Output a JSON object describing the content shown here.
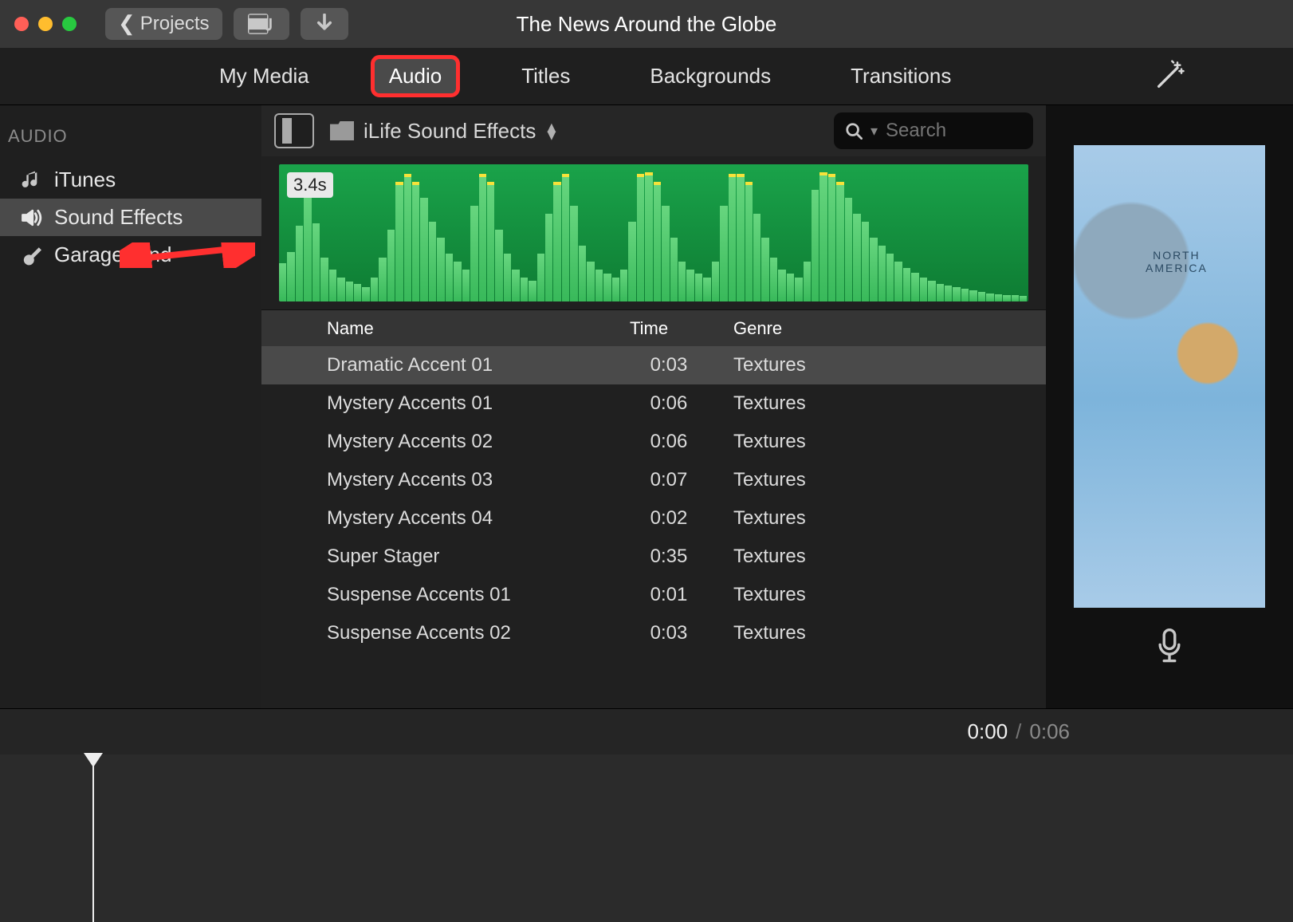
{
  "window": {
    "title": "The News Around the Globe"
  },
  "toolbar": {
    "projects_label": "Projects"
  },
  "tabs": {
    "items": [
      {
        "label": "My Media"
      },
      {
        "label": "Audio"
      },
      {
        "label": "Titles"
      },
      {
        "label": "Backgrounds"
      },
      {
        "label": "Transitions"
      }
    ],
    "active_index": 1
  },
  "sidebar": {
    "header": "AUDIO",
    "items": [
      {
        "label": "iTunes",
        "icon": "music-note-icon"
      },
      {
        "label": "Sound Effects",
        "icon": "speaker-icon"
      },
      {
        "label": "GarageBand",
        "icon": "guitar-icon"
      }
    ],
    "selected_index": 1
  },
  "browser": {
    "library_name": "iLife Sound Effects",
    "search_placeholder": "Search",
    "waveform_duration": "3.4s",
    "columns": {
      "name": "Name",
      "time": "Time",
      "genre": "Genre"
    },
    "rows": [
      {
        "name": "Dramatic Accent 01",
        "time": "0:03",
        "genre": "Textures"
      },
      {
        "name": "Mystery Accents 01",
        "time": "0:06",
        "genre": "Textures"
      },
      {
        "name": "Mystery Accents 02",
        "time": "0:06",
        "genre": "Textures"
      },
      {
        "name": "Mystery Accents 03",
        "time": "0:07",
        "genre": "Textures"
      },
      {
        "name": "Mystery Accents 04",
        "time": "0:02",
        "genre": "Textures"
      },
      {
        "name": "Super Stager",
        "time": "0:35",
        "genre": "Textures"
      },
      {
        "name": "Suspense Accents 01",
        "time": "0:01",
        "genre": "Textures"
      },
      {
        "name": "Suspense Accents 02",
        "time": "0:03",
        "genre": "Textures"
      }
    ],
    "selected_row": 0
  },
  "playback": {
    "current": "0:00",
    "duration": "0:06"
  },
  "annotations": {
    "arrow_target": "sidebar-panel-toggle",
    "highlight_tab": "Audio"
  }
}
